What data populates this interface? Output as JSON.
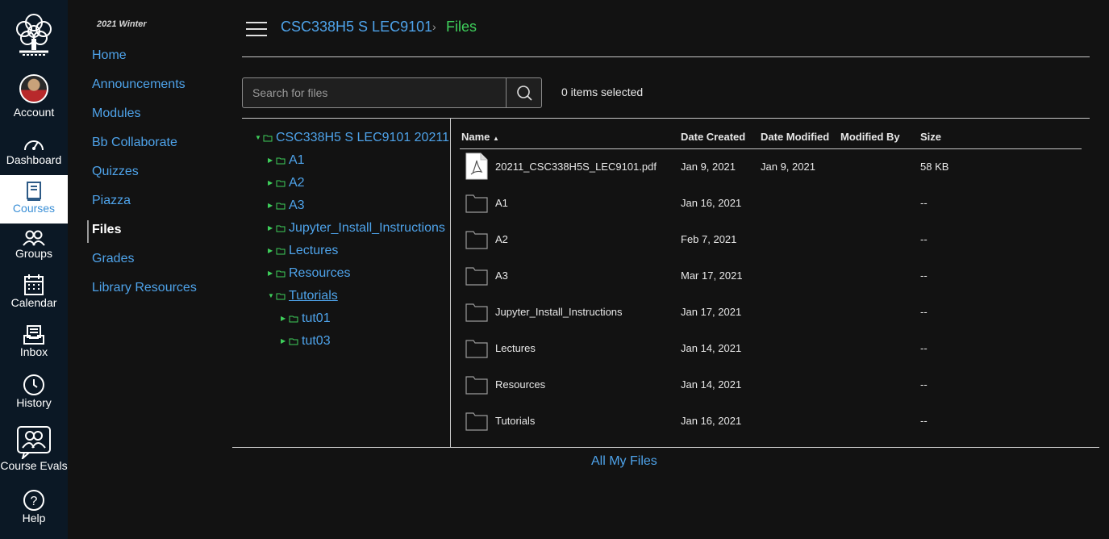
{
  "global_nav": {
    "account": "Account",
    "dashboard": "Dashboard",
    "courses": "Courses",
    "groups": "Groups",
    "calendar": "Calendar",
    "inbox": "Inbox",
    "history": "History",
    "course_evals": "Course Evals",
    "help": "Help"
  },
  "course_nav": {
    "term": "2021 Winter",
    "items": [
      "Home",
      "Announcements",
      "Modules",
      "Bb Collaborate",
      "Quizzes",
      "Piazza",
      "Files",
      "Grades",
      "Library Resources"
    ],
    "active": "Files"
  },
  "breadcrumb": {
    "course": "CSC338H5 S LEC9101",
    "separator": "›",
    "current": "Files"
  },
  "search": {
    "placeholder": "Search for files"
  },
  "selection_status": "0 items selected",
  "tree": {
    "root": "CSC338H5 S LEC9101 20211",
    "folders": [
      "A1",
      "A2",
      "A3",
      "Jupyter_Install_Instructions",
      "Lectures",
      "Resources",
      "Tutorials"
    ],
    "tutorials_children": [
      "tut01",
      "tut03"
    ]
  },
  "table": {
    "headers": {
      "name": "Name",
      "sort_indicator": "▲",
      "created": "Date Created",
      "modified": "Date Modified",
      "modified_by": "Modified By",
      "size": "Size"
    },
    "rows": [
      {
        "name": "20211_CSC338H5S_LEC9101.pdf",
        "created": "Jan 9, 2021",
        "modified": "Jan 9, 2021",
        "modified_by": "",
        "size": "58 KB",
        "icon": "pdf-file-icon"
      },
      {
        "name": "A1",
        "created": "Jan 16, 2021",
        "modified": "",
        "modified_by": "",
        "size": "--",
        "icon": "folder-icon"
      },
      {
        "name": "A2",
        "created": "Feb 7, 2021",
        "modified": "",
        "modified_by": "",
        "size": "--",
        "icon": "folder-icon"
      },
      {
        "name": "A3",
        "created": "Mar 17, 2021",
        "modified": "",
        "modified_by": "",
        "size": "--",
        "icon": "folder-icon"
      },
      {
        "name": "Jupyter_Install_Instructions",
        "created": "Jan 17, 2021",
        "modified": "",
        "modified_by": "",
        "size": "--",
        "icon": "folder-icon"
      },
      {
        "name": "Lectures",
        "created": "Jan 14, 2021",
        "modified": "",
        "modified_by": "",
        "size": "--",
        "icon": "folder-icon"
      },
      {
        "name": "Resources",
        "created": "Jan 14, 2021",
        "modified": "",
        "modified_by": "",
        "size": "--",
        "icon": "folder-icon"
      },
      {
        "name": "Tutorials",
        "created": "Jan 16, 2021",
        "modified": "",
        "modified_by": "",
        "size": "--",
        "icon": "folder-icon"
      }
    ]
  },
  "footer_link": "All My Files",
  "colors": {
    "background": "#121212",
    "global_nav": "#0b1825",
    "link": "#4ea3ea",
    "accent_green": "#3ecf5b"
  }
}
